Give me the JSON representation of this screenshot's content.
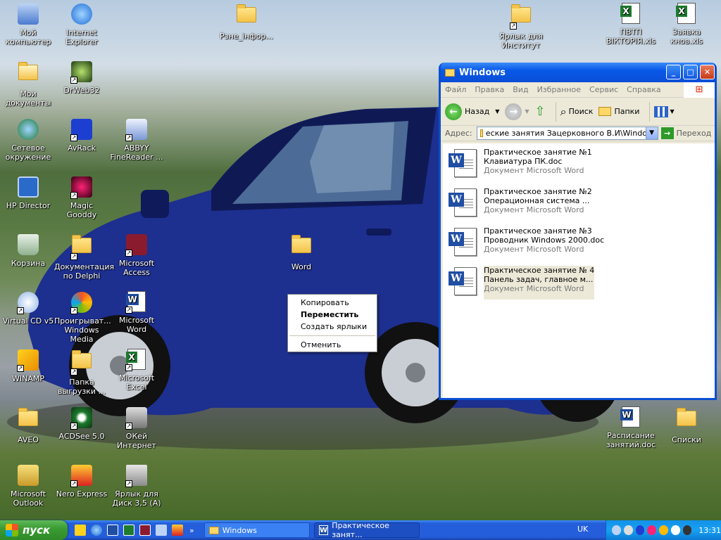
{
  "desktop": {
    "icons": [
      {
        "label": "Мой компьютер",
        "icon": "my-computer-icon"
      },
      {
        "label": "Internet Explorer",
        "icon": "internet-explorer-icon"
      },
      {
        "label": "Рзне_інфор...",
        "icon": "folder-icon"
      },
      {
        "label": "Ярлык для Институт",
        "icon": "folder-shortcut-icon"
      },
      {
        "label": "ПВТП ВІКТОРІЯ.xls",
        "icon": "excel-file-icon"
      },
      {
        "label": "Заявка кнов.xls",
        "icon": "excel-file-icon"
      },
      {
        "label": "Мои документы",
        "icon": "my-documents-icon"
      },
      {
        "label": "DrWeb32",
        "icon": "drweb-icon"
      },
      {
        "label": "Сетевое окружение",
        "icon": "network-icon"
      },
      {
        "label": "AvRack",
        "icon": "avrack-icon"
      },
      {
        "label": "ABBYY FineReader ...",
        "icon": "abbyy-icon"
      },
      {
        "label": "HP Director",
        "icon": "hp-director-icon"
      },
      {
        "label": "Magic Gooddy",
        "icon": "magic-gooddy-icon"
      },
      {
        "label": "Корзина",
        "icon": "recycle-bin-icon"
      },
      {
        "label": "Документация по Delphi",
        "icon": "folder-icon"
      },
      {
        "label": "Microsoft Access",
        "icon": "access-icon"
      },
      {
        "label": "Word",
        "icon": "folder-icon"
      },
      {
        "label": "Virtual CD v5",
        "icon": "virtual-cd-icon"
      },
      {
        "label": "Проигрыват... Windows Media",
        "icon": "media-player-icon"
      },
      {
        "label": "Microsoft Word",
        "icon": "word-icon"
      },
      {
        "label": "WINAMP",
        "icon": "winamp-icon"
      },
      {
        "label": "Папка выгрузки ...",
        "icon": "hp-folder-icon"
      },
      {
        "label": "Microsoft Excel",
        "icon": "excel-icon"
      },
      {
        "label": "AVEO",
        "icon": "folder-icon"
      },
      {
        "label": "ACDSee 5.0",
        "icon": "acdsee-icon"
      },
      {
        "label": "ОКей Интернет",
        "icon": "okey-internet-icon"
      },
      {
        "label": "Расписание занятий.doc",
        "icon": "word-doc-icon"
      },
      {
        "label": "Списки",
        "icon": "folder-icon"
      },
      {
        "label": "Microsoft Outlook",
        "icon": "outlook-icon"
      },
      {
        "label": "Nero Express",
        "icon": "nero-icon"
      },
      {
        "label": "Ярлык для Диск 3,5 (A)",
        "icon": "floppy-icon"
      }
    ]
  },
  "window": {
    "title": "Windows",
    "menu": [
      "Файл",
      "Правка",
      "Вид",
      "Избранное",
      "Сервис",
      "Справка"
    ],
    "toolbar": {
      "back": "Назад",
      "search": "Поиск",
      "folders": "Папки"
    },
    "address_label": "Адрес:",
    "address_value": "еские занятия Зацерковного В.И\\Windows",
    "go_label": "Переход",
    "files": [
      {
        "name1": "Практическое занятие №1",
        "name2": "Клавиатура ПК.doc",
        "type": "Документ Microsoft Word"
      },
      {
        "name1": "Практическое занятие №2",
        "name2": "Операционная система ...",
        "type": "Документ Microsoft Word"
      },
      {
        "name1": "Практическое занятие №3",
        "name2": "Проводник Windows 2000.doc",
        "type": "Документ Microsoft Word"
      },
      {
        "name1": "Практическое занятие № 4",
        "name2": "Панель задач, главное м...",
        "type": "Документ Microsoft Word"
      }
    ]
  },
  "context_menu": {
    "copy": "Копировать",
    "move": "Переместить",
    "shortcut": "Создать ярлыки",
    "cancel": "Отменить"
  },
  "taskbar": {
    "start": "пуск",
    "tasks": [
      "Windows",
      "Практическое занят..."
    ],
    "lang": "UK",
    "clock": "13:31",
    "more": "»"
  }
}
